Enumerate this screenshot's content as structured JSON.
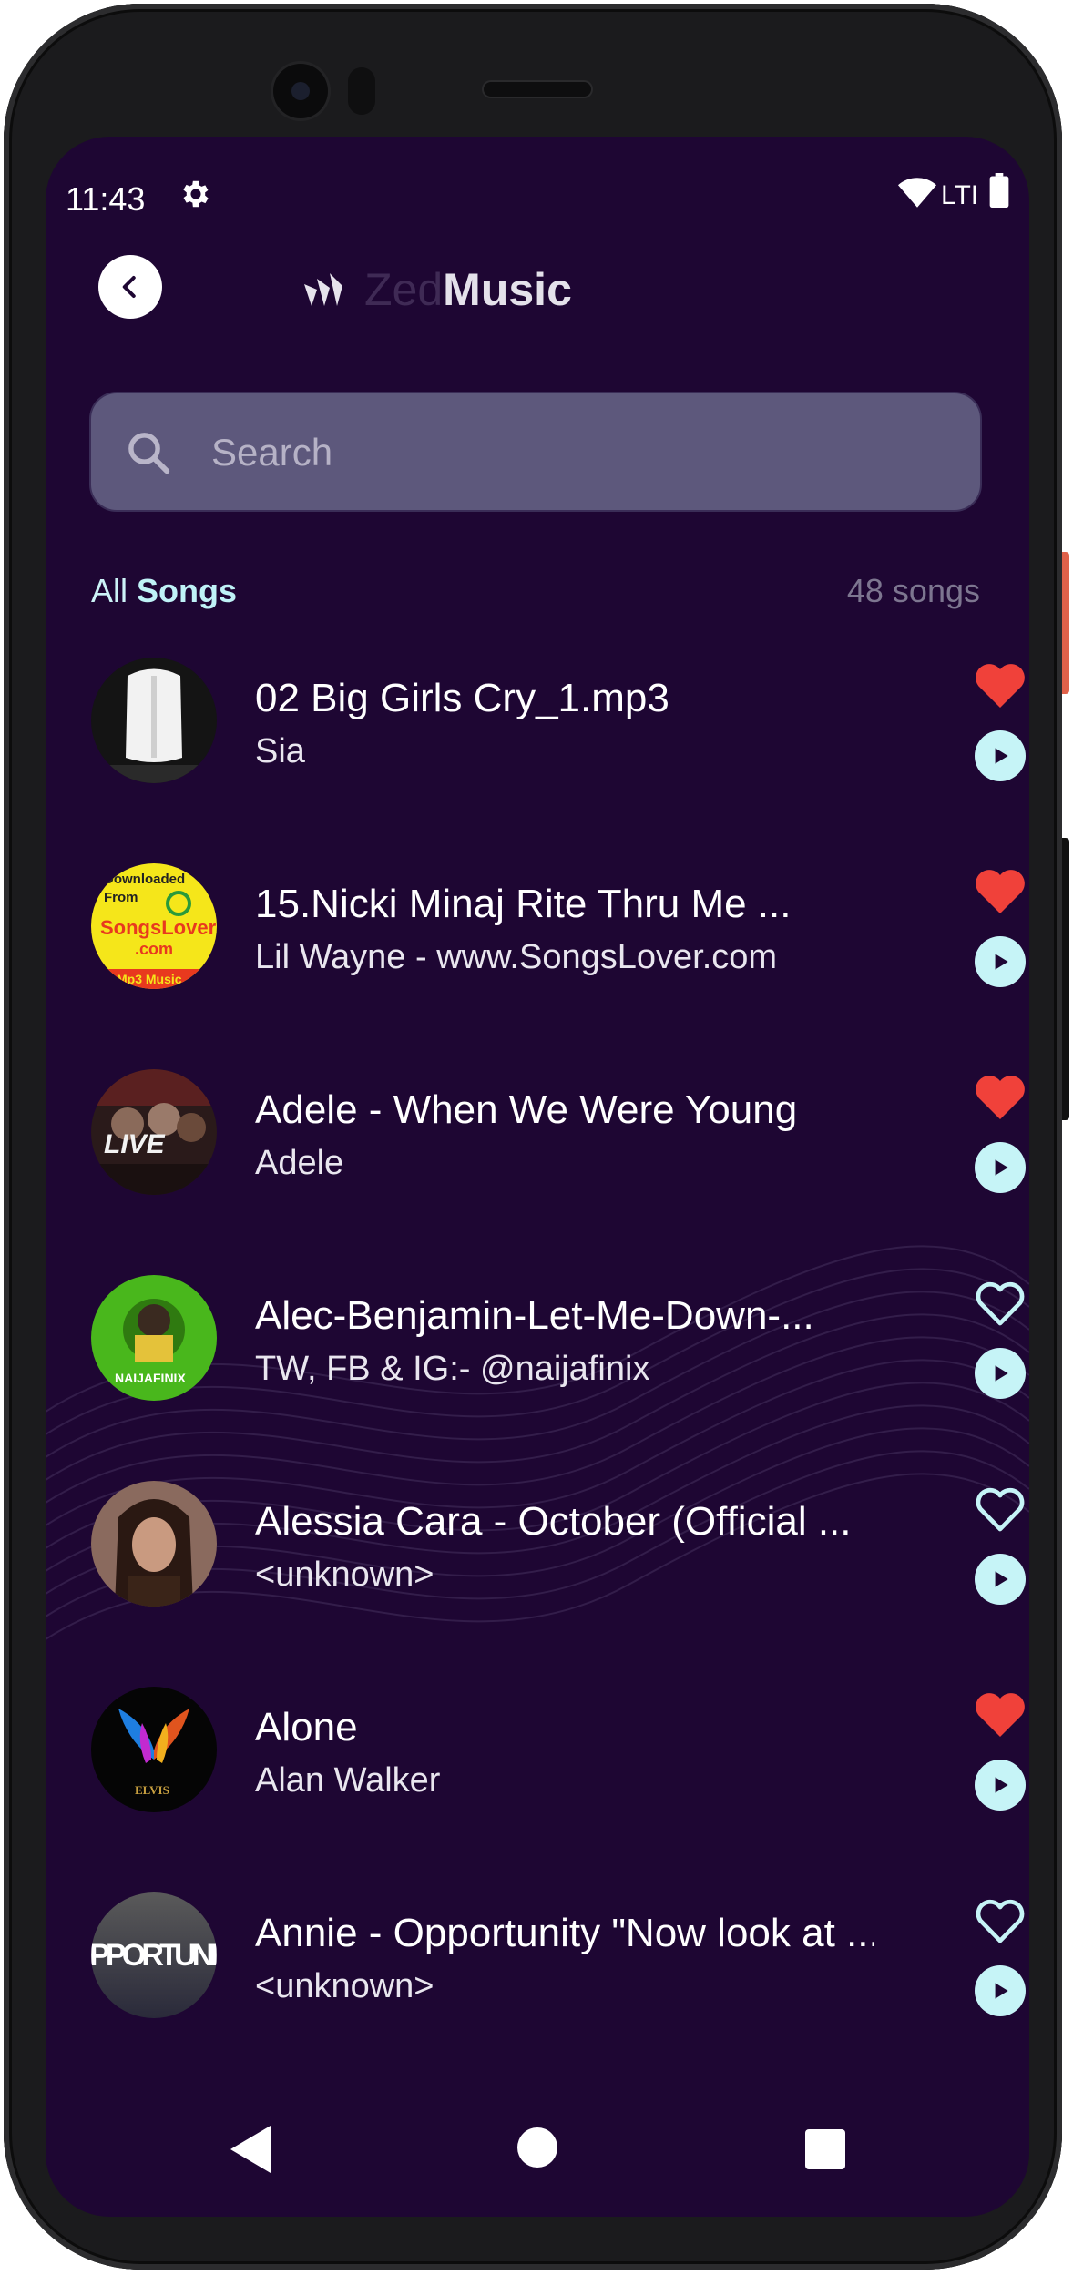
{
  "status_bar": {
    "time": "11:43",
    "network": "LTI"
  },
  "header": {
    "logo_part1": "Zed",
    "logo_part2": "Music"
  },
  "search": {
    "placeholder": "Search"
  },
  "section": {
    "label_all": "All ",
    "label_songs": "Songs",
    "count": "48 songs"
  },
  "colors": {
    "background": "#1e0633",
    "accent": "#c6f4f7",
    "heart": "#f0413a",
    "search_bg": "#5d587c"
  },
  "songs": [
    {
      "title": "02 Big Girls Cry_1.mp3",
      "artist": "Sia",
      "favorite": true,
      "art_icon": "sia-wig-art"
    },
    {
      "title": "15.Nicki Minaj Rite Thru Me ...",
      "artist": "Lil Wayne - www.SongsLover.com",
      "favorite": true,
      "art_icon": "songslover-art",
      "art_text": [
        "Downloaded",
        "From",
        "SongsLover",
        ".com",
        "Mp3 Music"
      ]
    },
    {
      "title": "Adele - When We Were Young",
      "artist": "Adele",
      "favorite": true,
      "art_icon": "mixtape-art",
      "art_text": [
        "LIVE"
      ]
    },
    {
      "title": "Alec-Benjamin-Let-Me-Down-...",
      "artist": "TW, FB & IG:-  @naijafinix",
      "favorite": false,
      "art_icon": "naijafinix-art",
      "art_text": [
        "NAIJAFINIX"
      ]
    },
    {
      "title": "Alessia Cara - October (Official ...",
      "artist": "<unknown>",
      "favorite": false,
      "art_icon": "portrait-art"
    },
    {
      "title": "Alone",
      "artist": "Alan Walker",
      "favorite": true,
      "art_icon": "birds-art",
      "art_text": [
        "ELVIS"
      ]
    },
    {
      "title": "Annie - Opportunity \"Now look at ...",
      "artist": "<unknown>",
      "favorite": false,
      "art_icon": "opportunity-art",
      "art_text": [
        "PPORTUNI"
      ]
    }
  ]
}
